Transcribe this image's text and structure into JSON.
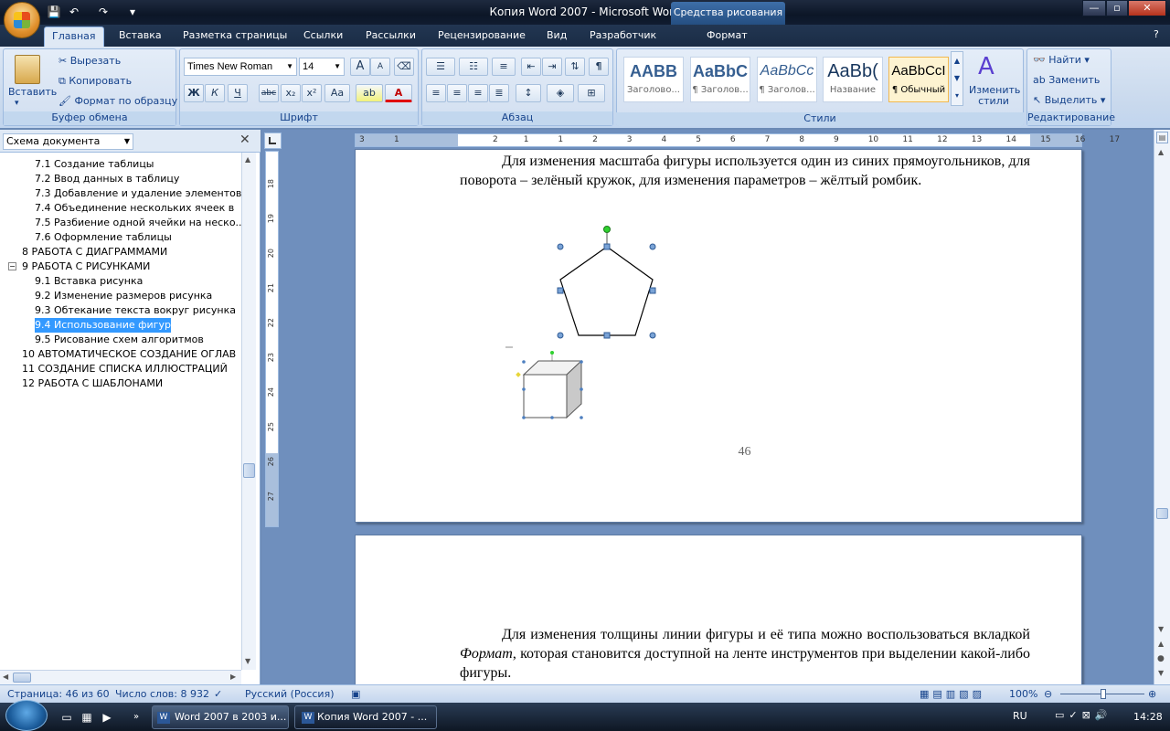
{
  "window": {
    "title": "Копия Word 2007 - Microsoft Word",
    "context_tab_title": "Средства рисования"
  },
  "tabs": [
    "Главная",
    "Вставка",
    "Разметка страницы",
    "Ссылки",
    "Рассылки",
    "Рецензирование",
    "Вид",
    "Разработчик",
    "Формат"
  ],
  "ribbon": {
    "clipboard": {
      "label": "Буфер обмена",
      "paste": "Вставить",
      "cut": "Вырезать",
      "copy": "Копировать",
      "format_painter": "Формат по образцу"
    },
    "font": {
      "label": "Шрифт",
      "font_name": "Times New Roman",
      "font_size": "14",
      "bold": "Ж",
      "italic": "К",
      "underline": "Ч",
      "strike": "abc",
      "sub": "x₂",
      "sup": "x²",
      "case": "Aa",
      "grow": "A",
      "shrink": "A"
    },
    "paragraph": {
      "label": "Абзац",
      "pilcrow": "¶"
    },
    "styles": {
      "label": "Стили",
      "items": [
        {
          "preview": "AABB",
          "name": "Заголово..."
        },
        {
          "preview": "AaBbC",
          "name": "¶ Заголов..."
        },
        {
          "preview": "AaBbCc",
          "name": "¶ Заголов..."
        },
        {
          "preview": "AaBb(",
          "name": "Название"
        },
        {
          "preview": "AaBbCcI",
          "name": "¶ Обычный"
        }
      ],
      "change_styles": "Изменить стили"
    },
    "editing": {
      "label": "Редактирование",
      "find": "Найти",
      "replace": "Заменить",
      "select": "Выделить"
    }
  },
  "docmap": {
    "view_combo": "Схема документа",
    "items": [
      {
        "text": "7.1 Создание таблицы",
        "level": 2
      },
      {
        "text": "7.2 Ввод данных в таблицу",
        "level": 2
      },
      {
        "text": "7.3 Добавление и удаление элементов",
        "level": 2
      },
      {
        "text": "7.4 Объединение нескольких ячеек в",
        "level": 2
      },
      {
        "text": "7.5 Разбиение одной ячейки на неско...",
        "level": 2
      },
      {
        "text": "7.6 Оформление таблицы",
        "level": 2
      },
      {
        "text": "8 РАБОТА С ДИАГРАММАМИ",
        "level": 1
      },
      {
        "text": "9 РАБОТА С РИСУНКАМИ",
        "level": 1,
        "expanded": true
      },
      {
        "text": "9.1 Вставка рисунка",
        "level": 2
      },
      {
        "text": "9.2 Изменение размеров рисунка",
        "level": 2
      },
      {
        "text": "9.3 Обтекание текста вокруг рисунка",
        "level": 2
      },
      {
        "text": "9.4 Использование фигур",
        "level": 2,
        "selected": true
      },
      {
        "text": "9.5 Рисование схем алгоритмов",
        "level": 2
      },
      {
        "text": "10 АВТОМАТИЧЕСКОЕ СОЗДАНИЕ ОГЛАВ",
        "level": 1
      },
      {
        "text": "11 СОЗДАНИЕ СПИСКА ИЛЛЮСТРАЦИЙ",
        "level": 1
      },
      {
        "text": "12 РАБОТА С ШАБЛОНАМИ",
        "level": 1
      }
    ]
  },
  "document": {
    "page1_text": "Для изменения масштаба фигуры используется один из синих прямоугольников, для поворота – зелёный кружок, для изменения параметров – жёлтый ромбик.",
    "page_number": "46",
    "page2_text_before": "Для изменения толщины линии фигуры и её типа можно воспользоваться вкладкой ",
    "page2_italic": "Формат",
    "page2_text_after": ", которая становится доступной на ленте инструментов при выделении какой-либо фигуры.",
    "hruler_marks": [
      "3",
      "1",
      "2",
      "1",
      "1",
      "2",
      "3",
      "4",
      "5",
      "6",
      "7",
      "8",
      "9",
      "10",
      "11",
      "12",
      "13",
      "14",
      "15",
      "16",
      "17"
    ],
    "vruler_marks": [
      "18",
      "19",
      "20",
      "21",
      "22",
      "23",
      "24",
      "25",
      "26",
      "27"
    ]
  },
  "status": {
    "page": "Страница: 46 из 60",
    "words": "Число слов: 8 932",
    "language": "Русский (Россия)",
    "zoom": "100%"
  },
  "taskbar": {
    "buttons": [
      {
        "label": "Word 2007 в 2003 и..."
      },
      {
        "label": "Копия Word 2007 - ..."
      }
    ],
    "lang": "RU",
    "time": "14:28"
  },
  "colors": {
    "ribbon": "#c9d9ed",
    "accent": "#15428b",
    "selection": "#3399ff"
  }
}
